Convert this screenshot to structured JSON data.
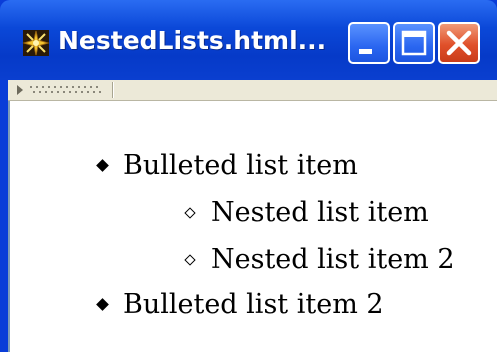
{
  "window": {
    "title": "NestedLists.html...",
    "app_icon": "ie-app-icon",
    "controls": {
      "minimize": "minimize-icon",
      "maximize": "maximize-icon",
      "close": "close-icon"
    }
  },
  "toolbar": {
    "grip": "toolbar-grip-icon"
  },
  "content": {
    "list": [
      {
        "label": "Bulleted list item",
        "bullet": "disc",
        "children": [
          {
            "label": "Nested list item",
            "bullet": "circle"
          },
          {
            "label": "Nested list item 2",
            "bullet": "circle"
          }
        ]
      },
      {
        "label": "Bulleted list item 2",
        "bullet": "disc",
        "children": []
      }
    ]
  },
  "colors": {
    "titlebar": "#0b48d8",
    "close_button": "#e0502a",
    "toolbar": "#ece9d8",
    "content_background": "#ffffff"
  }
}
